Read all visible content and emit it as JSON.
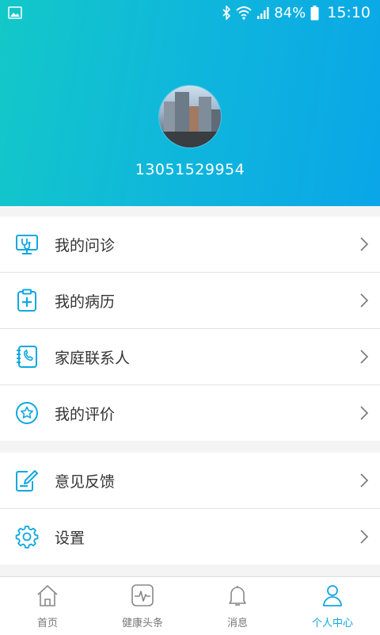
{
  "status_bar": {
    "battery": "84%",
    "time": "15:10"
  },
  "profile": {
    "phone": "13051529954"
  },
  "menu_group_1": [
    {
      "label": "我的问诊",
      "icon": "doctor-consult-icon"
    },
    {
      "label": "我的病历",
      "icon": "medical-record-icon"
    },
    {
      "label": "家庭联系人",
      "icon": "phone-contact-icon"
    },
    {
      "label": "我的评价",
      "icon": "star-rating-icon"
    }
  ],
  "menu_group_2": [
    {
      "label": "意见反馈",
      "icon": "feedback-edit-icon"
    },
    {
      "label": "设置",
      "icon": "gear-icon"
    }
  ],
  "tabbar": {
    "items": [
      {
        "label": "首页",
        "icon": "home-icon"
      },
      {
        "label": "健康头条",
        "icon": "pulse-icon"
      },
      {
        "label": "消息",
        "icon": "bell-icon"
      },
      {
        "label": "个人中心",
        "icon": "user-icon"
      }
    ],
    "active_index": 3
  },
  "colors": {
    "accent": "#10a8e0",
    "header_start": "#13c8c8",
    "header_end": "#0aa6e8"
  }
}
